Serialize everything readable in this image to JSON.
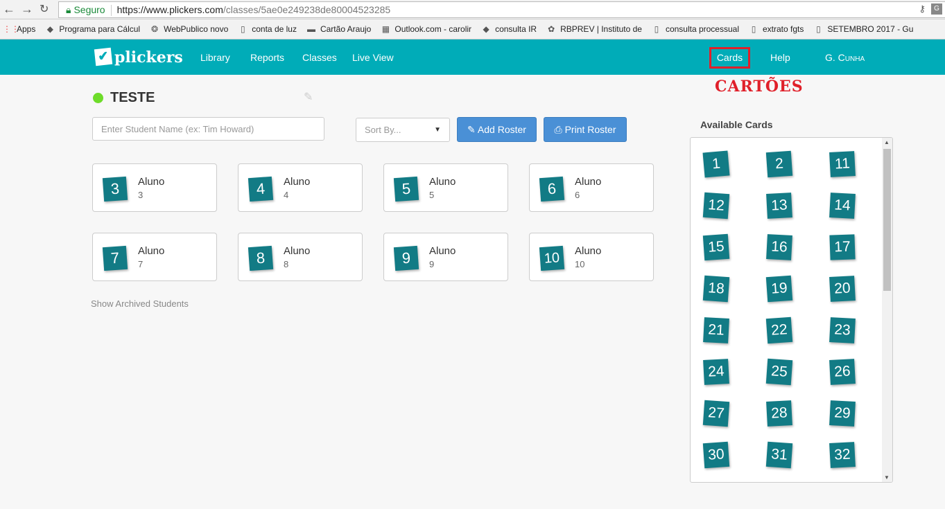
{
  "browser": {
    "secure_label": "Seguro",
    "url_host": "https://www.plickers.com",
    "url_path": "/classes/5ae0e249238de80004523285",
    "bookmarks": [
      "Apps",
      "Programa para Cálcul",
      "WebPublico novo",
      "conta de luz",
      "Cartão Araujo",
      "Outlook.com - carolir",
      "consulta IR",
      "RBPREV | Instituto de",
      "consulta processual",
      "extrato fgts",
      "SETEMBRO 2017 - Gu"
    ]
  },
  "nav": {
    "logo": "plickers",
    "links": [
      "Library",
      "Reports",
      "Classes",
      "Live View"
    ],
    "cards": "Cards",
    "help": "Help",
    "user": "G. Cunha"
  },
  "annotation": "CARTÕES",
  "class": {
    "name": "TESTE",
    "status_color": "#6edc2a"
  },
  "search": {
    "placeholder": "Enter Student Name (ex: Tim Howard)"
  },
  "sort": {
    "label": "Sort By..."
  },
  "buttons": {
    "add_roster": "Add Roster",
    "print_roster": "Print Roster"
  },
  "students": [
    {
      "card": "3",
      "name": "Aluno",
      "num": "3"
    },
    {
      "card": "4",
      "name": "Aluno",
      "num": "4"
    },
    {
      "card": "5",
      "name": "Aluno",
      "num": "5"
    },
    {
      "card": "6",
      "name": "Aluno",
      "num": "6"
    },
    {
      "card": "7",
      "name": "Aluno",
      "num": "7"
    },
    {
      "card": "8",
      "name": "Aluno",
      "num": "8"
    },
    {
      "card": "9",
      "name": "Aluno",
      "num": "9"
    },
    {
      "card": "10",
      "name": "Aluno",
      "num": "10"
    }
  ],
  "archived_link": "Show Archived Students",
  "available": {
    "title": "Available Cards",
    "cards": [
      "1",
      "2",
      "11",
      "12",
      "13",
      "14",
      "15",
      "16",
      "17",
      "18",
      "19",
      "20",
      "21",
      "22",
      "23",
      "24",
      "25",
      "26",
      "27",
      "28",
      "29",
      "30",
      "31",
      "32"
    ]
  },
  "colors": {
    "nav": "#00acb8",
    "card": "#127b85",
    "button": "#4a90d6",
    "annotation": "#e0202a"
  }
}
